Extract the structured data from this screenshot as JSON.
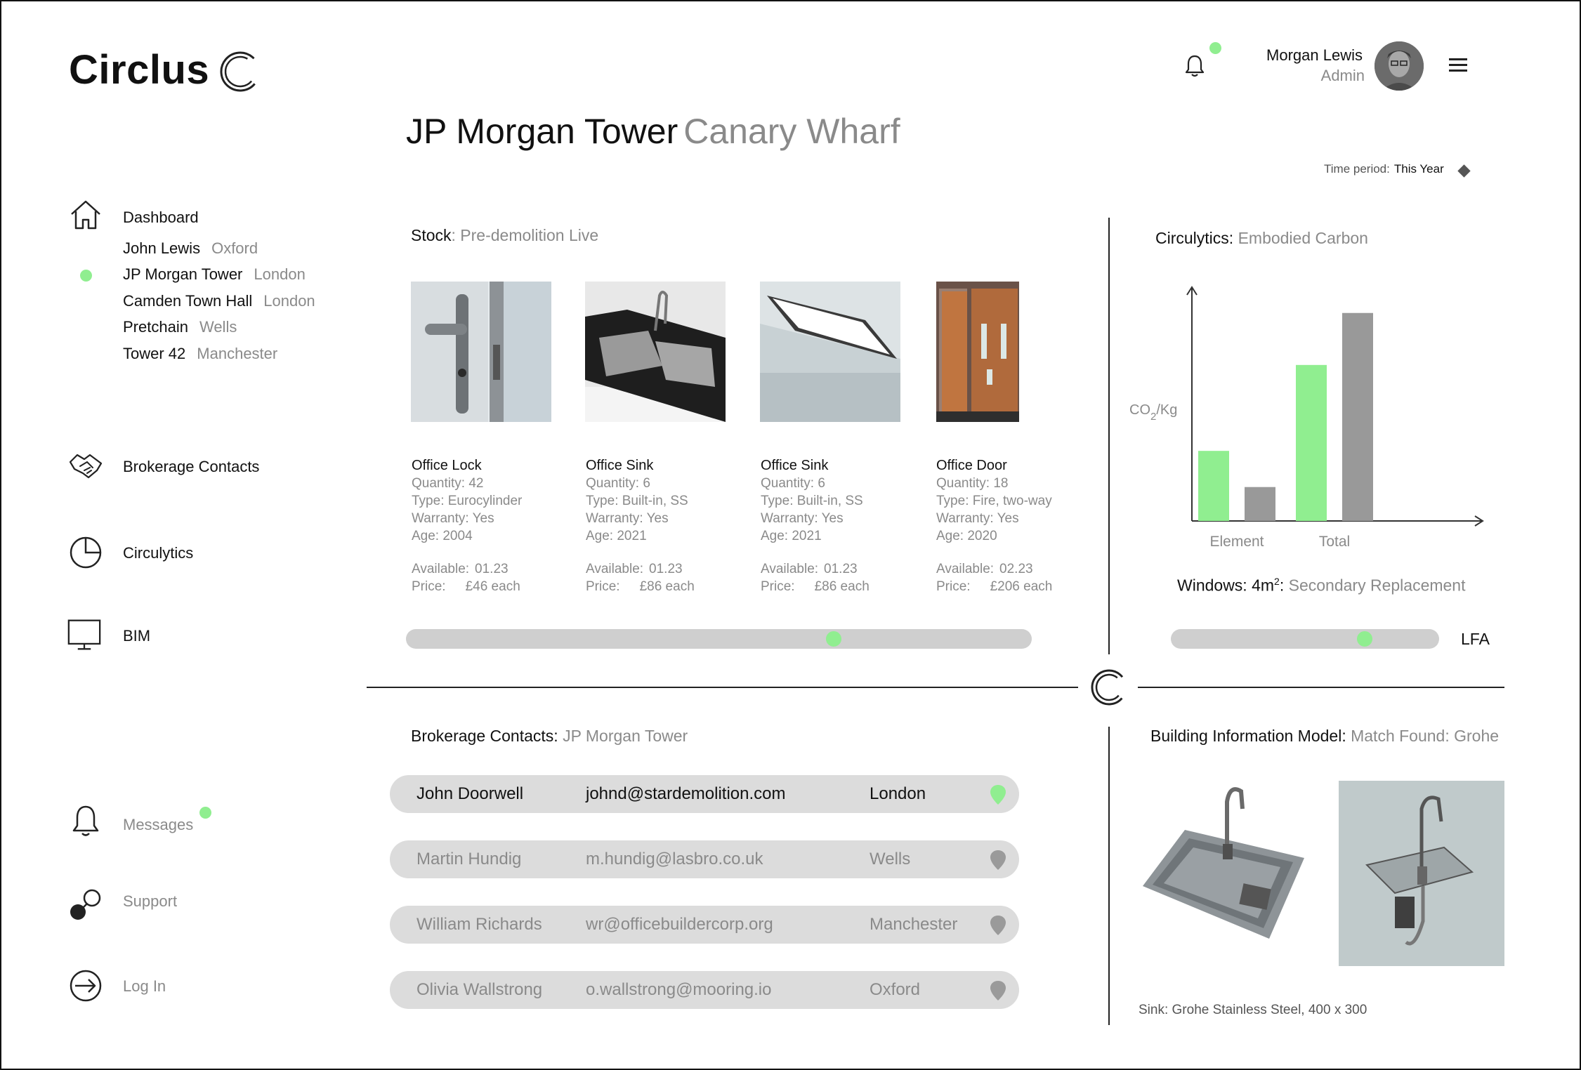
{
  "app": {
    "name": "Circlus"
  },
  "user": {
    "name": "Morgan Lewis",
    "role": "Admin"
  },
  "page": {
    "title": "JP Morgan Tower",
    "subtitle": "Canary Wharf"
  },
  "time_period": {
    "label": "Time period:",
    "value": "This Year"
  },
  "sidebar": {
    "dashboard": "Dashboard",
    "projects": [
      {
        "name": "John Lewis",
        "city": "Oxford",
        "active": false
      },
      {
        "name": "JP Morgan Tower",
        "city": "London",
        "active": true
      },
      {
        "name": "Camden Town Hall",
        "city": "London",
        "active": false
      },
      {
        "name": "Pretchain",
        "city": "Wells",
        "active": false
      },
      {
        "name": "Tower 42",
        "city": "Manchester",
        "active": false
      }
    ],
    "brokerage": "Brokerage Contacts",
    "circulytics": "Circulytics",
    "bim": "BIM",
    "messages": "Messages",
    "support": "Support",
    "login": "Log In"
  },
  "stock": {
    "title": "Stock",
    "subtitle": ": Pre-demolition",
    "status": "Live",
    "slider_position": 0.69,
    "items": [
      {
        "name": "Office Lock",
        "quantity": "Quantity: 42",
        "type": "Type: Eurocylinder",
        "warranty": "Warranty: Yes",
        "age": "Age: 2004",
        "available_label": "Available:",
        "available": "01.23",
        "price_label": "Price:",
        "price": "£46 each"
      },
      {
        "name": "Office Sink",
        "quantity": "Quantity: 6",
        "type": "Type: Built-in, SS",
        "warranty": "Warranty: Yes",
        "age": "Age: 2021",
        "available_label": "Available:",
        "available": "01.23",
        "price_label": "Price:",
        "price": "£86 each"
      },
      {
        "name": "Office Sink",
        "quantity": "Quantity: 6",
        "type": "Type: Built-in, SS",
        "warranty": "Warranty: Yes",
        "age": "Age: 2021",
        "available_label": "Available:",
        "available": "01.23",
        "price_label": "Price:",
        "price": "£86 each"
      },
      {
        "name": "Office Door",
        "quantity": "Quantity: 18",
        "type": "Type: Fire, two-way",
        "warranty": "Warranty: Yes",
        "age": "Age: 2020",
        "available_label": "Available:",
        "available": "02.23",
        "price_label": "Price:",
        "price": "£206 each"
      }
    ]
  },
  "circulytics": {
    "title": "Circulytics:",
    "subtitle": "Embodied Carbon",
    "windows_label": "Windows: 4m",
    "windows_sup": "2",
    "windows_sep": ":",
    "windows_value": "Secondary Replacement",
    "lfa": "LFA",
    "slider_position": 0.74
  },
  "chart_data": {
    "type": "bar",
    "categories": [
      "Element",
      "Total"
    ],
    "ylabel_main": "CO",
    "ylabel_sub": "2",
    "ylabel_tail": "/Kg",
    "series": [
      {
        "values": [
          0.31,
          0.69
        ],
        "color": "#90ee90"
      },
      {
        "values": [
          0.15,
          0.92
        ],
        "color": "#999999"
      }
    ],
    "ylim": [
      0,
      1
    ],
    "grid": false
  },
  "brokerage": {
    "title": "Brokerage Contacts:",
    "subtitle": "JP Morgan Tower",
    "contacts": [
      {
        "name": "John Doorwell",
        "email": "johnd@stardemolition.com",
        "city": "London",
        "active": true
      },
      {
        "name": "Martin Hundig",
        "email": "m.hundig@lasbro.co.uk",
        "city": "Wells",
        "active": false
      },
      {
        "name": "William Richards",
        "email": "wr@officebuildercorp.org",
        "city": "Manchester",
        "active": false
      },
      {
        "name": "Olivia Wallstrong",
        "email": "o.wallstrong@mooring.io",
        "city": "Oxford",
        "active": false
      }
    ]
  },
  "bim": {
    "title": "Building Information Model:",
    "subtitle": "Match Found: Grohe",
    "caption": "Sink: Grohe Stainless Steel, 400 x 300"
  },
  "colors": {
    "accent": "#90ee90",
    "grey_bar": "#999999",
    "track": "#cfcfcf",
    "row": "#dcdcdc"
  }
}
